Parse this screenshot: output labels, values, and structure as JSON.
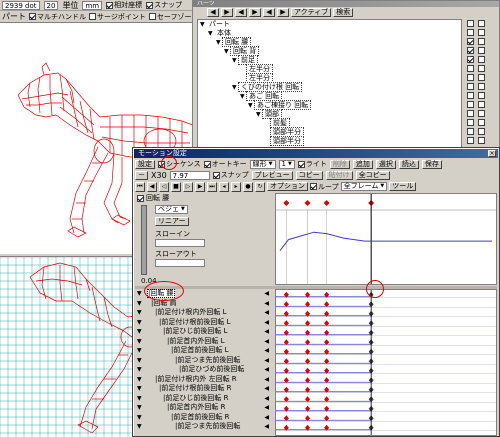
{
  "view": {
    "readout": "2939 dot",
    "zoom": "20",
    "unit_label": "単位",
    "unit_value": "mm",
    "relative_coords_label": "相対座標",
    "snap_label": "スナップ",
    "toolbar2_left": "パート",
    "multi_handle_label": "マルチハンドル",
    "surge_point_label": "サージポイント",
    "safe_zone_label": "セーフゾーン"
  },
  "parts": {
    "title": "パーツ",
    "toolbar": [
      "◀",
      "▶",
      "◀",
      "▶",
      "◀",
      "▶"
    ],
    "active_label": "アクティブ",
    "search_label": "検索",
    "tree": [
      {
        "level": 0,
        "label": "パート",
        "toggle": "▼"
      },
      {
        "level": 1,
        "label": "本体",
        "toggle": "▼"
      },
      {
        "level": 2,
        "label": "回転 腰",
        "toggle": "▼",
        "boxed": true
      },
      {
        "level": 3,
        "label": "回転 背",
        "toggle": "▼",
        "boxed": true
      },
      {
        "level": 4,
        "label": "前足",
        "toggle": "▼",
        "boxed": true
      },
      {
        "level": 5,
        "label": "左半分",
        "toggle": "",
        "boxed": true
      },
      {
        "level": 5,
        "label": "左半分",
        "toggle": "",
        "boxed": true
      },
      {
        "level": 4,
        "label": "くびの付け根 回転",
        "toggle": "▼",
        "boxed": true
      },
      {
        "level": 5,
        "label": "あご 回転",
        "toggle": "▼",
        "boxed": true
      },
      {
        "level": 6,
        "label": "あご棟接り 回転",
        "toggle": "▼",
        "boxed": true
      },
      {
        "level": 7,
        "label": "頭部",
        "toggle": "▼",
        "boxed": true
      },
      {
        "level": 8,
        "label": "前髪",
        "toggle": "",
        "boxed": true
      },
      {
        "level": 8,
        "label": "頭部半分",
        "toggle": "",
        "boxed": true
      },
      {
        "level": 8,
        "label": "頭部半分",
        "toggle": "",
        "boxed": true
      }
    ]
  },
  "motion": {
    "title": "モーション設定",
    "close_glyph": "×",
    "menu": {
      "settings": "設定",
      "sequence": "シーケンス",
      "auto_key": "オートキー",
      "interp_combo": "線形",
      "interp_value": "1",
      "light": "ライト",
      "delete_key": "削除",
      "add_key": "追加",
      "select": "選択",
      "read": "読込",
      "save": "保存"
    },
    "row2": {
      "minus": "－",
      "zoom_readout": "X30",
      "time_readout": "7.97",
      "snap": "スナップ",
      "preview": "プレビュー",
      "copy": "コピー",
      "paste": "貼付け",
      "copy_all": "全コピー"
    },
    "row3": {
      "options": "オプション",
      "loop": "ループ",
      "all_frames": "全フレーム",
      "tools": "ツール"
    },
    "curve": {
      "label": "回転 腰",
      "bezier": "ベジェ",
      "slow_in": "スローイン",
      "slow_out": "スローアウト",
      "linear": "リニアー",
      "value": "0.04",
      "curve_points": [
        [
          0,
          0.55
        ],
        [
          4,
          0.4
        ],
        [
          10,
          0.35
        ],
        [
          16,
          0.3
        ],
        [
          22,
          0.32
        ],
        [
          30,
          0.38
        ],
        [
          40,
          0.42
        ],
        [
          52,
          0.42
        ],
        [
          70,
          0.42
        ],
        [
          100,
          0.42
        ]
      ],
      "key_times": [
        3,
        13,
        22,
        43
      ],
      "playhead": 43
    },
    "tracks": [
      {
        "indent": 0,
        "label": "回転 腰",
        "highlight": true
      },
      {
        "indent": 1,
        "label": "回転 肩"
      },
      {
        "indent": 2,
        "label": "前足付け根内外回転 L"
      },
      {
        "indent": 3,
        "label": "前足付け根前後回転 L"
      },
      {
        "indent": 4,
        "label": "前足ひじ前後回転 L"
      },
      {
        "indent": 5,
        "label": "前足首内外回転 L"
      },
      {
        "indent": 6,
        "label": "前足首前後回転 L"
      },
      {
        "indent": 7,
        "label": "前足つま先前後回転"
      },
      {
        "indent": 8,
        "label": "前足ひづめ前後回転"
      },
      {
        "indent": 2,
        "label": "前足付け根内外 左回転 R"
      },
      {
        "indent": 3,
        "label": "前足付け根前後回転 R"
      },
      {
        "indent": 4,
        "label": "前足ひじ前後回転 R"
      },
      {
        "indent": 5,
        "label": "前足首内外回転 R"
      },
      {
        "indent": 6,
        "label": "前足首前後回転 R"
      },
      {
        "indent": 7,
        "label": "前足つま先前後回転"
      }
    ],
    "track_keys": [
      3,
      13,
      22,
      43
    ]
  },
  "colors": {
    "wire": "#e00000",
    "grid": "#00a0a0",
    "key": "#e00000",
    "curve": "#4040c0",
    "title_active": "#0a246a"
  }
}
